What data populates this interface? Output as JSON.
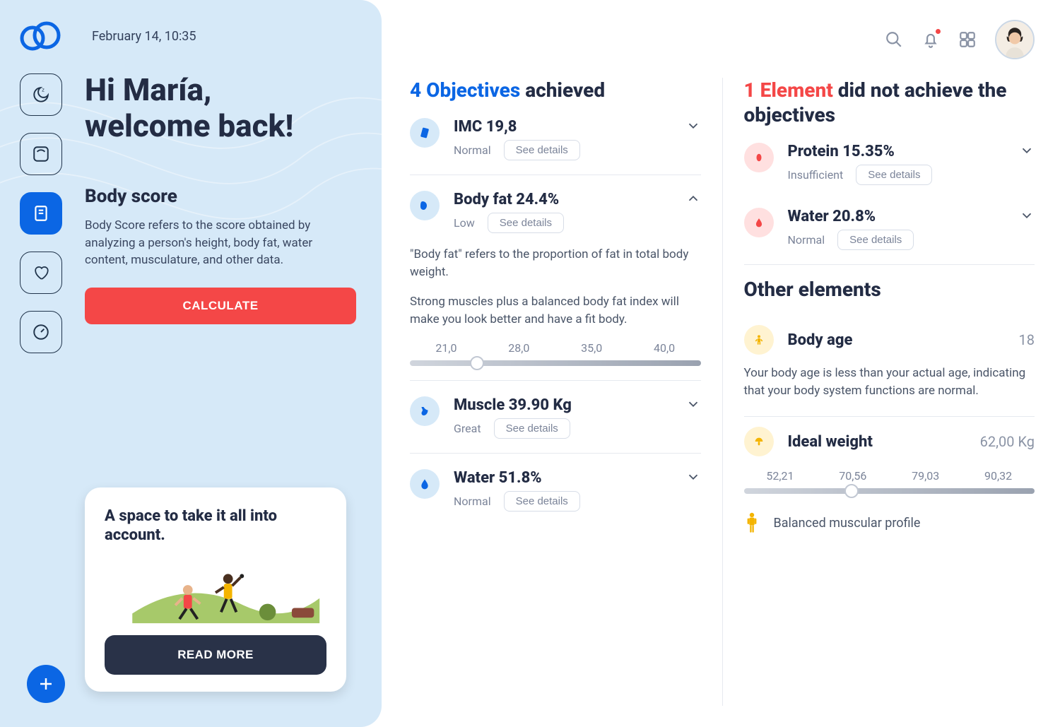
{
  "header": {
    "date": "February 14, 10:35"
  },
  "nav": {
    "items": [
      "moon",
      "weight",
      "notes",
      "heart",
      "timer"
    ],
    "active_index": 2
  },
  "welcome": {
    "line1": "Hi María,",
    "line2": "welcome back!"
  },
  "bodyscore": {
    "title": "Body score",
    "desc": "Body Score refers to the score obtained by analyzing a person's height, body fat, water content, musculature, and other data.",
    "cta": "CALCULATE"
  },
  "promo": {
    "title": "A space to take it all into account.",
    "cta": "READ MORE"
  },
  "objectives": {
    "count": "4 Objectives",
    "suffix": " achieved",
    "items": [
      {
        "icon": "imc",
        "title": "IMC 19,8",
        "status": "Normal",
        "expanded": false
      },
      {
        "icon": "bodyfat",
        "title": "Body fat 24.4%",
        "status": "Low",
        "expanded": true,
        "detail_p1": "\"Body fat\" refers to the proportion of fat in total body weight.",
        "detail_p2": "Strong muscles plus a balanced body fat index will make you look better and have a fit body.",
        "ticks": [
          "21,0",
          "28,0",
          "35,0",
          "40,0"
        ],
        "thumb_percent": 23
      },
      {
        "icon": "muscle",
        "title": "Muscle 39.90 Kg",
        "status": "Great",
        "expanded": false
      },
      {
        "icon": "water",
        "title": "Water 51.8%",
        "status": "Normal",
        "expanded": false
      }
    ],
    "detail_label": "See details"
  },
  "failed": {
    "count": "1 Element",
    "suffix": " did not achieve the objectives",
    "items": [
      {
        "icon": "protein",
        "title": "Protein 15.35%",
        "status": "Insufficient"
      },
      {
        "icon": "water",
        "title": "Water 20.8%",
        "status": "Normal"
      }
    ],
    "detail_label": "See details"
  },
  "other": {
    "title": "Other elements",
    "body_age": {
      "label": "Body age",
      "value": "18",
      "desc": "Your body age is less than your actual age, indicating that your body system functions are normal."
    },
    "ideal_weight": {
      "label": "Ideal weight",
      "value": "62,00 Kg",
      "ticks": [
        "52,21",
        "70,56",
        "79,03",
        "90,32"
      ],
      "thumb_percent": 37
    },
    "profile": "Balanced muscular profile"
  }
}
